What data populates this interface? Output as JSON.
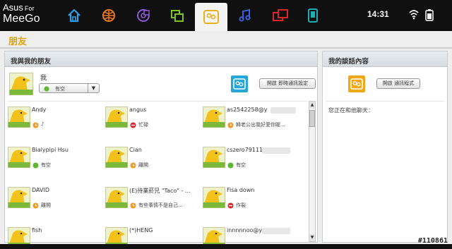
{
  "topbar": {
    "brand_line1": "Asus",
    "brand_for": "For",
    "brand_line2": "MeeGo",
    "icons": [
      "home-icon",
      "web-icon",
      "media-icon",
      "apps-icon",
      "people-icon",
      "music-icon",
      "tasks-icon",
      "devices-icon"
    ],
    "active_icon": "people-icon",
    "time": "14:31",
    "system_icons": [
      "wifi-icon",
      "battery-icon"
    ]
  },
  "page": {
    "title": "朋友"
  },
  "friends_panel": {
    "title": "我與我的朋友",
    "me": {
      "name": "我",
      "status": "有空",
      "im_settings_button": "開啟 即時通訊設定"
    },
    "friends": [
      {
        "name": "Andy",
        "status": "♪",
        "presence": "away"
      },
      {
        "name": "angus",
        "status": "忙碌",
        "presence": "busy"
      },
      {
        "name": "as2542258@y",
        "status": "韓老公出我好愛你喔...",
        "presence": "away"
      },
      {
        "name": "Bialypipi Hsu",
        "status": "有空",
        "presence": "available"
      },
      {
        "name": "Cian",
        "status": "離開",
        "presence": "away"
      },
      {
        "name": "cszero791119@",
        "status": "有空",
        "presence": "available"
      },
      {
        "name": "DAVID",
        "status": "離開",
        "presence": "away"
      },
      {
        "name": "(E)待業菸兄 \"Taco\" - ...",
        "status": "有些事情不是自己...",
        "presence": "away"
      },
      {
        "name": "Fisa down",
        "status": "作裂",
        "presence": "busy"
      },
      {
        "name": "fish",
        "status": "",
        "presence": "away"
      },
      {
        "name": "(*)HENG",
        "status": "",
        "presence": "away"
      },
      {
        "name": "innnnnoo@y",
        "status": "",
        "presence": "away"
      }
    ]
  },
  "chat_panel": {
    "title": "我的談話內容",
    "open_button": "開啟 通訊程式",
    "chatting_with_label": "您正在和他聊天："
  },
  "colors": {
    "accent": "#e2a400",
    "available": "#5cb82e",
    "away": "#f09a1e",
    "busy": "#d8262a"
  },
  "watermark": "#110861"
}
